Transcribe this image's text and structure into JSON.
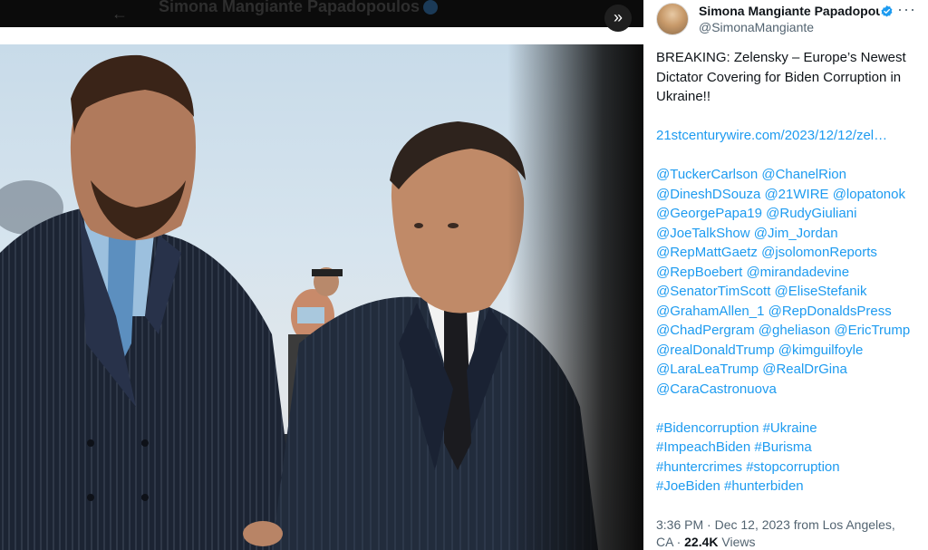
{
  "background_header": {
    "back_arrow": "←",
    "name": "Simona Mangiante Papadopoulos"
  },
  "expand_button_icon": "»",
  "author": {
    "name": "Simona Mangiante Papadopou",
    "handle": "@SimonaMangiante",
    "more_icon": "···"
  },
  "tweet": {
    "headline_lines": [
      "BREAKING: Zelensky – Europe’s Newest",
      "Dictator Covering for Biden Corruption in",
      "Ukraine!!"
    ],
    "link": "21stcenturywire.com/2023/12/12/zel…",
    "mentions_lines": [
      "@TuckerCarlson @ChanelRion",
      "@DineshDSouza @21WIRE @lopatonok",
      "@GeorgePapa19 @RudyGiuliani",
      "@JoeTalkShow @Jim_Jordan",
      "@RepMattGaetz @jsolomonReports",
      "@RepBoebert @mirandadevine",
      "@SenatorTimScott @EliseStefanik",
      "@GrahamAllen_1 @RepDonaldsPress",
      "@ChadPergram @gheliason @EricTrump",
      "@realDonaldTrump @kimguilfoyle",
      "@LaraLeaTrump @RealDrGina",
      "@CaraCastronuova"
    ],
    "hashtags_lines": [
      "#Bidencorruption #Ukraine",
      "#ImpeachBiden #Burisma",
      "#huntercrimes #stopcorruption",
      "#JoeBiden #hunterbiden"
    ]
  },
  "meta": {
    "line1": "3:36 PM · Dec 12, 2023 from Los Angeles,",
    "line2_prefix": "CA · ",
    "views_count": "22.4K",
    "views_label": " Views"
  },
  "colors": {
    "link": "#1d9bf0",
    "text": "#0f1419",
    "secondary": "#536471",
    "verified": "#1d9bf0"
  }
}
